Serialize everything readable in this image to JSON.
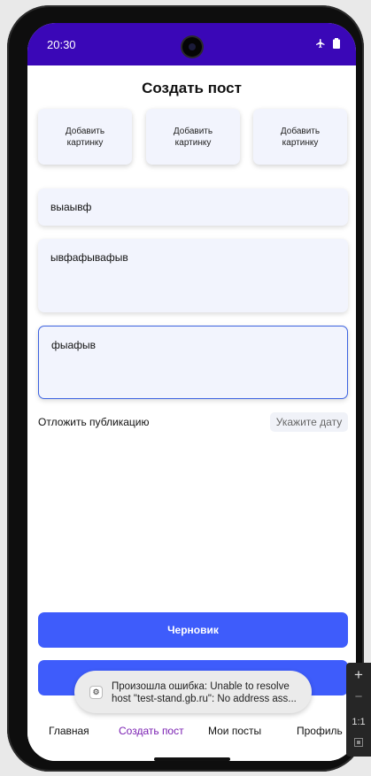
{
  "status_bar": {
    "time": "20:30",
    "icons": [
      "airplane-mode-icon",
      "battery-icon"
    ],
    "color": "#3a07b7"
  },
  "page": {
    "title": "Создать пост"
  },
  "image_buttons": [
    {
      "label": "Добавить картинку"
    },
    {
      "label": "Добавить картинку"
    },
    {
      "label": "Добавить картинку"
    }
  ],
  "fields": {
    "title_value": "выаывф",
    "description_value": "ывфафывафыв",
    "tags_value": "фыафыв"
  },
  "schedule": {
    "label": "Отложить публикацию",
    "date_button": "Укажите дату"
  },
  "buttons": {
    "draft": "Черновик",
    "accent": "#3e5cfb"
  },
  "toast": {
    "line1": "Произошла ошибка: Unable to resolve",
    "line2": "host \"test-stand.gb.ru\": No address ass..."
  },
  "nav": {
    "home": "Главная",
    "create": "Создать пост",
    "my_posts": "Мои посты",
    "profile": "Профиль",
    "active_color": "#7a1fb2"
  },
  "emulator_toolbar": {
    "zoom_in": "+",
    "zoom_out": "−",
    "one_to_one": "1:1"
  }
}
